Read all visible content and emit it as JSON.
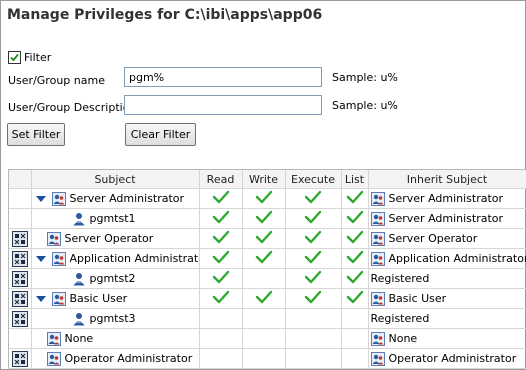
{
  "title": "Manage Privileges for C:\\ibi\\apps\\app06",
  "filter": {
    "label": "Filter",
    "checked": true
  },
  "user_group_name": {
    "label": "User/Group name",
    "value": "pgm%",
    "sample": "Sample: u%"
  },
  "user_group_desc": {
    "label": "User/Group Description",
    "value": "",
    "sample": "Sample: u%"
  },
  "buttons": {
    "set_filter": "Set Filter",
    "clear_filter": "Clear Filter"
  },
  "columns": {
    "subject": "Subject",
    "read": "Read",
    "write": "Write",
    "execute": "Execute",
    "list": "List",
    "inherit": "Inherit Subject"
  },
  "rows": [
    {
      "subject": "Server Administrator",
      "read": true,
      "write": true,
      "execute": true,
      "list": true,
      "inherit": "Server Administrator"
    },
    {
      "subject": "pgmtst1",
      "read": true,
      "write": true,
      "execute": true,
      "list": true,
      "inherit": "Server Administrator"
    },
    {
      "subject": "Server Operator",
      "read": true,
      "write": true,
      "execute": true,
      "list": true,
      "inherit": "Server Operator"
    },
    {
      "subject": "Application Administrator",
      "read": true,
      "write": true,
      "execute": true,
      "list": true,
      "inherit": "Application Administrator"
    },
    {
      "subject": "pgmtst2",
      "read": true,
      "write": false,
      "execute": true,
      "list": true,
      "inherit": "Registered"
    },
    {
      "subject": "Basic User",
      "read": true,
      "write": true,
      "execute": true,
      "list": true,
      "inherit": "Basic User"
    },
    {
      "subject": "pgmtst3",
      "read": false,
      "write": false,
      "execute": false,
      "list": false,
      "inherit": "Registered"
    },
    {
      "subject": "None",
      "read": false,
      "write": false,
      "execute": false,
      "list": false,
      "inherit": "None"
    },
    {
      "subject": "Operator Administrator",
      "read": false,
      "write": false,
      "execute": false,
      "list": false,
      "inherit": "Operator Administrator"
    }
  ],
  "colors": {
    "check": "#2ea82e",
    "title": "#333333",
    "tree_arrow": "#1a4f9a"
  }
}
